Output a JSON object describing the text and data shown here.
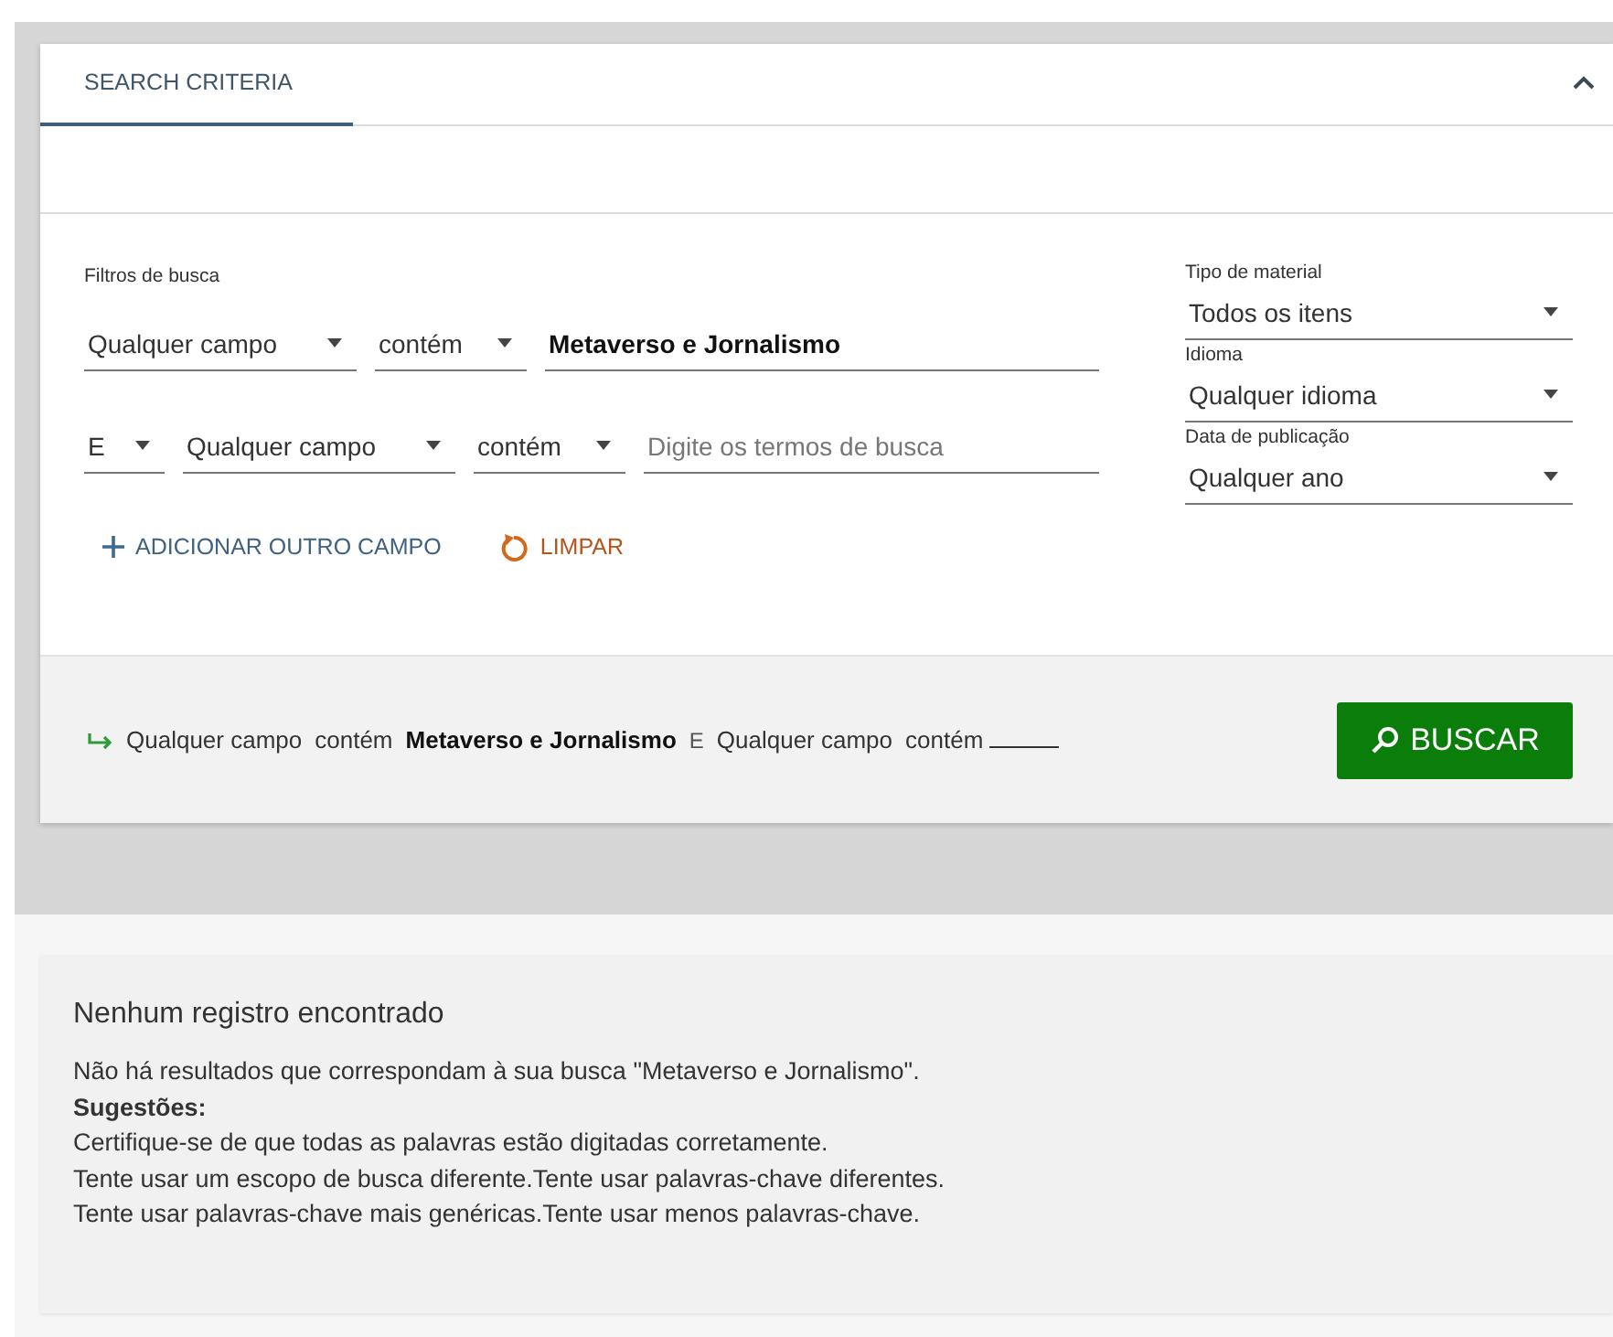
{
  "tabs": [
    {
      "label": "SEARCH CRITERIA",
      "selected": true
    }
  ],
  "filters": {
    "label": "Filtros de busca",
    "rows": [
      [
        {
          "kind": "select",
          "value": "Qualquer campo"
        },
        {
          "kind": "select",
          "value": "contém"
        },
        {
          "kind": "input",
          "value": "Metaverso e Jornalismo"
        }
      ],
      [
        {
          "kind": "bool",
          "value": "E"
        },
        {
          "kind": "select",
          "value": "Qualquer campo"
        },
        {
          "kind": "select",
          "value": "contém"
        },
        {
          "kind": "input",
          "placeholder": "Digite os termos de busca"
        }
      ]
    ]
  },
  "actions": [
    {
      "kind": "add",
      "label": "ADICIONAR OUTRO CAMPO"
    },
    {
      "kind": "clear",
      "label": "LIMPAR"
    }
  ],
  "facets": [
    {
      "label": "Tipo de material",
      "value": "Todos os itens"
    },
    {
      "label": "Idioma",
      "value": "Qualquer idioma"
    },
    {
      "label": "Data de publicação",
      "value": "Qualquer ano"
    }
  ],
  "query_summary": [
    {
      "kind": "field",
      "text": "Qualquer campo"
    },
    {
      "kind": "op",
      "text": "contém"
    },
    {
      "kind": "term",
      "text": "Metaverso e Jornalismo"
    },
    {
      "kind": "bool",
      "text": "E"
    },
    {
      "kind": "field",
      "text": "Qualquer campo"
    },
    {
      "kind": "op",
      "text": "contém"
    },
    {
      "kind": "blank"
    }
  ],
  "search_button": {
    "label": "BUSCAR"
  },
  "results": {
    "title": "Nenhum registro encontrado",
    "message": "Não há resultados que correspondam à sua busca \"Metaverso e Jornalismo\".",
    "suggestions_label": "Sugestões:",
    "suggestions": [
      "Certifique-se de que todas as palavras estão digitadas corretamente.",
      "Tente usar um escopo de busca diferente.Tente usar palavras-chave diferentes.",
      "Tente usar palavras-chave mais genéricas.Tente usar menos palavras-chave."
    ]
  }
}
